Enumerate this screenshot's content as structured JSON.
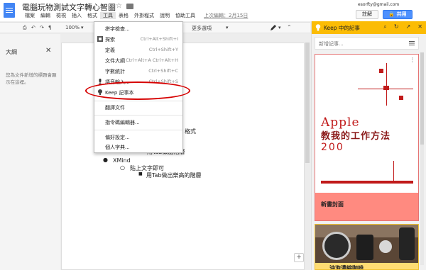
{
  "app": {
    "doc_title": "電腦玩物測試文字轉心智圖",
    "last_edit": "上次編輯：2月15日",
    "account": "esorfty@gmail.com",
    "comment_button": "註解",
    "share_button": "共用"
  },
  "menubar": {
    "items": [
      "檔案",
      "編輯",
      "檢視",
      "插入",
      "格式",
      "工具",
      "表格",
      "外掛程式",
      "說明",
      "協助工具"
    ],
    "active_index": 5
  },
  "toolbar": {
    "zoom": "100%",
    "more_options": "更多選項"
  },
  "outline": {
    "title": "大綱",
    "description": "您為文件新增的標題會顯示在這裡。"
  },
  "tools_menu": {
    "items": [
      {
        "label": "拼字檢查...",
        "shortcut": "",
        "icon": ""
      },
      {
        "label": "探索",
        "shortcut": "Ctrl+Alt+Shift+I",
        "icon": "explore-icon"
      },
      {
        "label": "定義",
        "shortcut": "Ctrl+Shift+Y",
        "icon": ""
      },
      {
        "label": "文件大綱",
        "shortcut": "Ctrl+Alt+A Ctrl+Alt+H",
        "icon": ""
      },
      {
        "label": "字數統計",
        "shortcut": "Ctrl+Shift+C",
        "icon": ""
      },
      {
        "label": "語音輸入...",
        "shortcut": "Ctrl+Shift+S",
        "icon": "mic-icon"
      },
      {
        "label": "Keep 記事本",
        "shortcut": "",
        "icon": "keep-icon"
      },
      {
        "label": "翻譯文件",
        "shortcut": "",
        "icon": ""
      },
      {
        "label": "指令碼編輯器...",
        "shortcut": "",
        "icon": ""
      },
      {
        "label": "偏好設定...",
        "shortcut": "",
        "icon": ""
      },
      {
        "label": "個人字典...",
        "shortcut": "",
        "icon": ""
      }
    ]
  },
  "document": {
    "lines": [
      {
        "text": "格式"
      },
      {
        "text": "用Tab做出階層"
      },
      {
        "text": "XMind"
      },
      {
        "text": "貼上文字即可"
      },
      {
        "text": "用Tab做出樂高的階層"
      }
    ]
  },
  "keep": {
    "title": "Keep 中的記事",
    "new_note_placeholder": "新增記事...",
    "notes": [
      {
        "title": "新書封面",
        "color": "#ff8a80",
        "cover_en": "Apple",
        "cover_cn": "教我的工作方法",
        "cover_num": "200"
      },
      {
        "title": "沖泡濃縮咖啡",
        "color": "#ffdc73"
      }
    ]
  },
  "colors": {
    "keep_header": "#fbbc05",
    "share_blue": "#4d90fe",
    "highlight_red": "#d60000"
  }
}
